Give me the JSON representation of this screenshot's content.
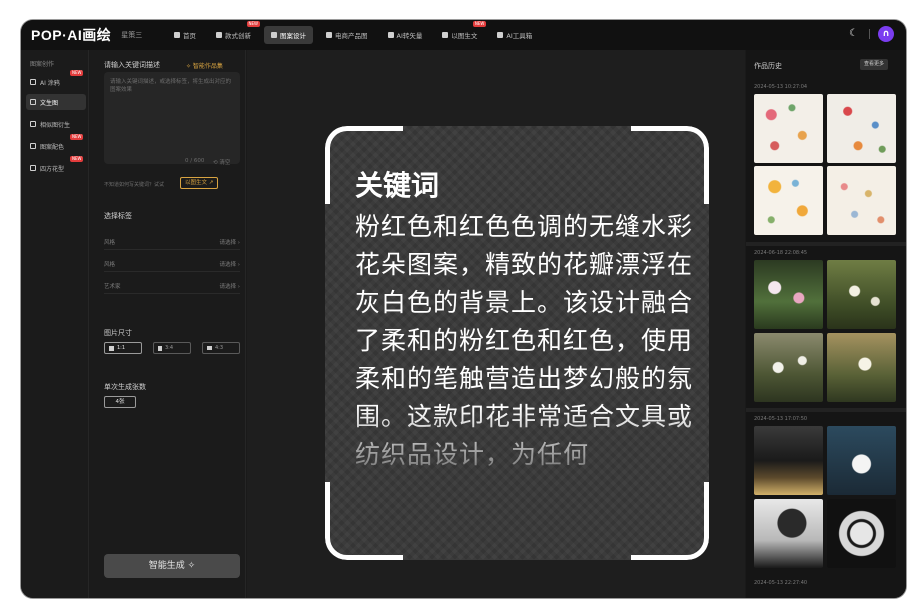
{
  "app": {
    "logo_text": "POP·AI画绘",
    "brand_sub": "星策三"
  },
  "nav": [
    {
      "label": "首页",
      "badge": ""
    },
    {
      "label": "款式创新",
      "badge": "NEW"
    },
    {
      "label": "图案设计",
      "badge": ""
    },
    {
      "label": "电商产品图",
      "badge": ""
    },
    {
      "label": "AI转矢量",
      "badge": ""
    },
    {
      "label": "以图生文",
      "badge": "NEW"
    },
    {
      "label": "AI工具箱",
      "badge": ""
    }
  ],
  "sidebar": {
    "heading": "图案创作",
    "items": [
      {
        "label": "AI 涂鸦",
        "badge": "NEW"
      },
      {
        "label": "文生图",
        "badge": ""
      },
      {
        "label": "相似图衍生",
        "badge": ""
      },
      {
        "label": "图案配色",
        "badge": "NEW"
      },
      {
        "label": "四方花型",
        "badge": "NEW"
      }
    ]
  },
  "panel": {
    "prompt_label": "请输入关键词描述",
    "smart_link": "✧ 智能作品集",
    "placeholder": "请输入关键词描述，或选择标签，将生成出对应的图案效果",
    "counter": "0 / 600",
    "clear_label": "⟲ 清空",
    "hint": "不知道如何写关键词？试试",
    "hint_button": "以图生文 ↗",
    "tags_label": "选择标签",
    "tag_rows": [
      {
        "label": "风格",
        "value": "请选择 ›"
      },
      {
        "label": "风格",
        "value": "请选择 ›"
      },
      {
        "label": "艺术家",
        "value": "请选择 ›"
      }
    ],
    "size_label": "图片尺寸",
    "sizes": [
      "1:1",
      "3:4",
      "4:3"
    ],
    "count_label": "单次生成张数",
    "count_value": "4张",
    "generate_label": "智能生成 ✧"
  },
  "overlay": {
    "title": "关键词",
    "body": "粉红色和红色色调的无缝水彩花朵图案，精致的花瓣漂浮在灰白色的背景上。该设计融合了柔和的粉红色和红色，使用柔和的笔触营造出梦幻般的氛围。这款印花非常适合文具或纺织品设计，为任何"
  },
  "history": {
    "title": "作品历史",
    "more": "查看更多",
    "groups": [
      {
        "date": "2024-05-13 10:27:04"
      },
      {
        "date": "2024-06-18 22:08:45"
      },
      {
        "date": "2024-05-13 17:07:50"
      },
      {
        "date": "2024-05-13 22:27:40"
      }
    ]
  },
  "colors": {
    "accent": "#d9a441",
    "badge": "#e33c3c",
    "avatar": "#7b3df0"
  }
}
